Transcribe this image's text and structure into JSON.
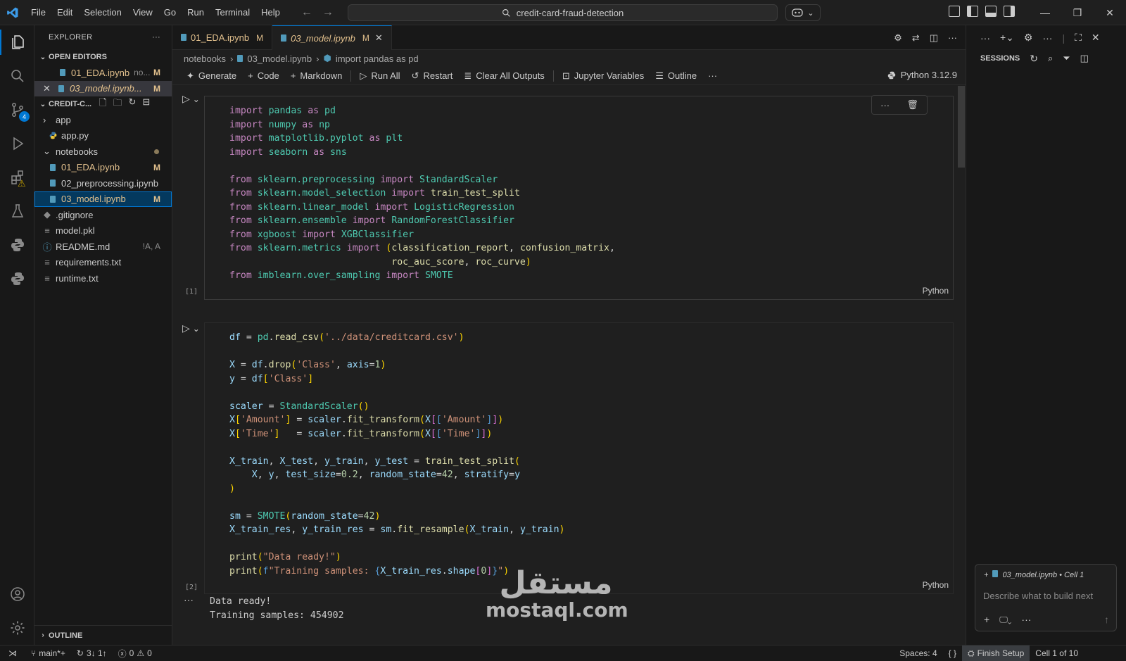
{
  "menu": [
    "File",
    "Edit",
    "Selection",
    "View",
    "Go",
    "Run",
    "Terminal",
    "Help"
  ],
  "command_center": {
    "text": "credit-card-fraud-detection"
  },
  "activity_badges": {
    "scm": "4"
  },
  "explorer": {
    "title": "EXPLORER",
    "open_editors_label": "OPEN EDITORS",
    "open_editors": [
      {
        "name": "01_EDA.ipynb",
        "desc": "no...",
        "status": "M"
      },
      {
        "name": "03_model.ipynb...",
        "status": "M"
      }
    ],
    "workspace_label": "CREDIT-C...",
    "tree": [
      {
        "name": "app",
        "status": ""
      },
      {
        "name": "app.py",
        "status": ""
      },
      {
        "name": "notebooks",
        "status": ""
      },
      {
        "name": "01_EDA.ipynb",
        "status": "M"
      },
      {
        "name": "02_preprocessing.ipynb",
        "status": ""
      },
      {
        "name": "03_model.ipynb",
        "status": "M"
      },
      {
        "name": ".gitignore",
        "status": ""
      },
      {
        "name": "model.pkl",
        "status": ""
      },
      {
        "name": "README.md",
        "status": "!A, A"
      },
      {
        "name": "requirements.txt",
        "status": ""
      },
      {
        "name": "runtime.txt",
        "status": ""
      }
    ],
    "outline_label": "OUTLINE"
  },
  "tabs": [
    {
      "label": "01_EDA.ipynb",
      "status": "M"
    },
    {
      "label": "03_model.ipynb",
      "status": "M"
    }
  ],
  "breadcrumb": {
    "folder": "notebooks",
    "file": "03_model.ipynb",
    "symbol": "import pandas as pd"
  },
  "toolbar": {
    "generate": "Generate",
    "code": "Code",
    "markdown": "Markdown",
    "run_all": "Run All",
    "restart": "Restart",
    "clear": "Clear All Outputs",
    "variables": "Jupyter Variables",
    "outline": "Outline",
    "kernel": "Python 3.12.9"
  },
  "cells": [
    {
      "exec": "[1]",
      "lang": "Python"
    },
    {
      "exec": "[2]",
      "lang": "Python"
    }
  ],
  "output": {
    "line1": "Data ready!",
    "line2": "Training samples: 454902"
  },
  "right_panel": {
    "sessions_label": "SESSIONS",
    "chat_context": "03_model.ipynb • Cell 1",
    "chat_placeholder": "Describe what to build next"
  },
  "watermark": {
    "arabic": "مستقل",
    "latin": "mostaql.com"
  },
  "statusbar": {
    "branch": "main*+",
    "sync": "3↓ 1↑",
    "errors": "0",
    "warnings": "0",
    "spaces": "Spaces: 4",
    "braces": "{ }",
    "finish": "Finish Setup",
    "cell": "Cell 1 of 10"
  }
}
